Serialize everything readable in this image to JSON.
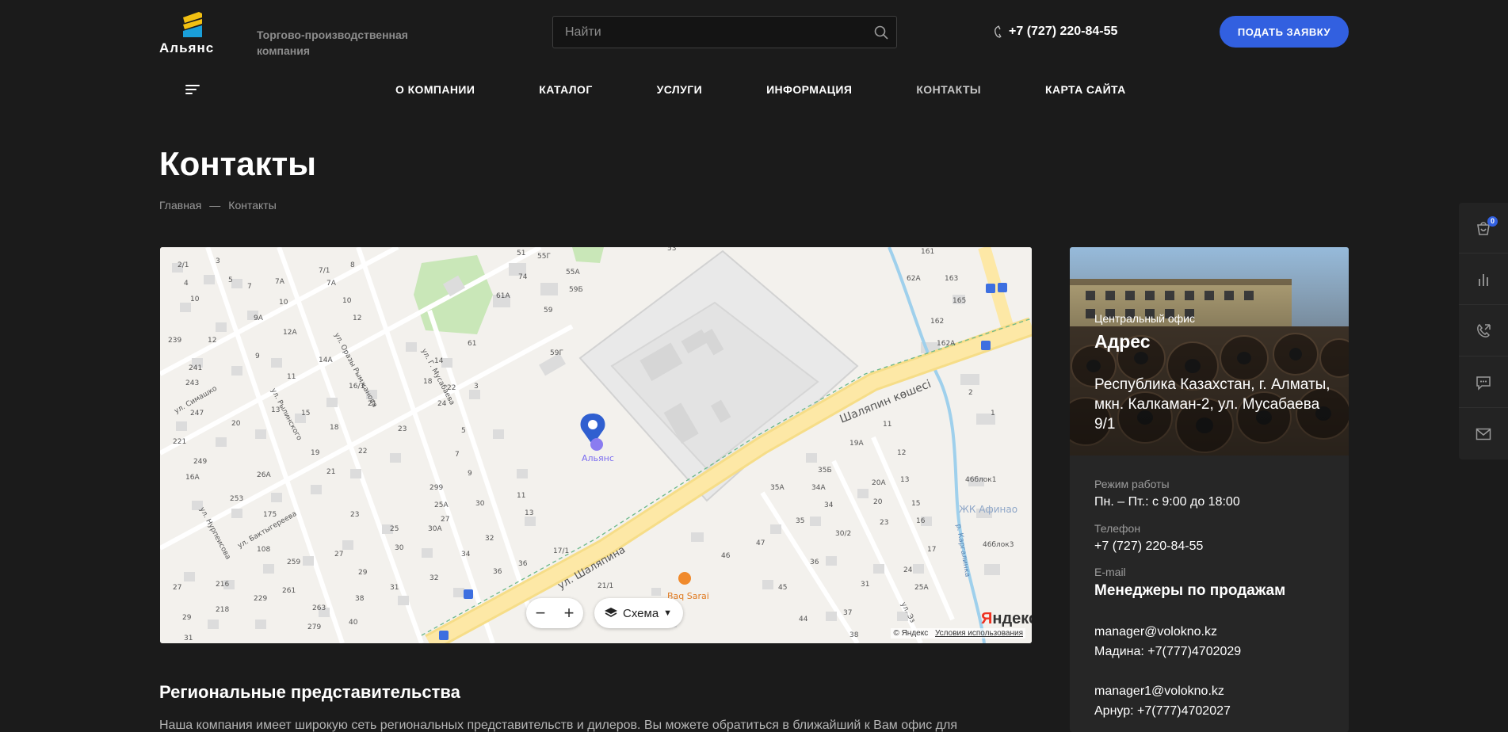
{
  "header": {
    "logo_text": "Альянс",
    "tagline": "Торгово-производственная компания",
    "search_placeholder": "Найти",
    "phone": "+7 (727) 220-84-55",
    "cta_label": "ПОДАТЬ ЗАЯВКУ"
  },
  "nav": {
    "items": [
      "О КОМПАНИИ",
      "КАТАЛОГ",
      "УСЛУГИ",
      "ИНФОРМАЦИЯ",
      "КОНТАКТЫ",
      "КАРТА САЙТА"
    ],
    "active": "КОНТАКТЫ"
  },
  "page": {
    "title": "Контакты",
    "breadcrumb": [
      "Главная",
      "—",
      "Контакты"
    ]
  },
  "map": {
    "marker_label": "Альянс",
    "street_main": "Шаляпин көшесі",
    "street_lower": "ул. Шаляпина",
    "poi": "Baq Sarai",
    "poi_district": "ЖК Афинао",
    "scheme_label": "Схема",
    "yandex_logo": "Яндекс",
    "copyright": "© Яндекс",
    "terms": "Условия использования",
    "streets": [
      "ул. Симашко",
      "ул. Рылинского",
      "ул. Оразы Рымжанова",
      "ул. Г. Мусабаева",
      "ул. Нурпеисова",
      "ул. Бактыгереева",
      "р. Каргалинка",
      "ул. Эз"
    ]
  },
  "card": {
    "office_label": "Центральный офис",
    "address_title": "Адрес",
    "address": "Республика Казахстан, г. Алматы, мкн. Калкаман-2, ул. Мусабаева 9/1",
    "hours_label": "Режим работы",
    "hours": "Пн. – Пт.: с 9:00 до 18:00",
    "phone_label": "Телефон",
    "phone": "+7 (727) 220-84-55",
    "email_label": "E-mail",
    "managers_title": "Менеджеры по продажам",
    "manager1_email": "manager@volokno.kz",
    "manager1_name": "Мадина: +7(777)4702029",
    "manager2_email": "manager1@volokno.kz",
    "manager2_name": "Арнур: +7(777)4702027"
  },
  "regional": {
    "title": "Региональные представительства",
    "text": "Наша компания имеет широкую сеть региональных представительств и дилеров. Вы можете обратиться в ближайший к Вам офис для"
  },
  "side_widget": {
    "cart_count": "0",
    "icons": [
      "cart-icon",
      "compare-icon",
      "callback-icon",
      "chat-icon",
      "mail-icon"
    ]
  },
  "colors": {
    "background": "#1b1b1b",
    "accent": "#3260e0",
    "card": "#262626"
  }
}
